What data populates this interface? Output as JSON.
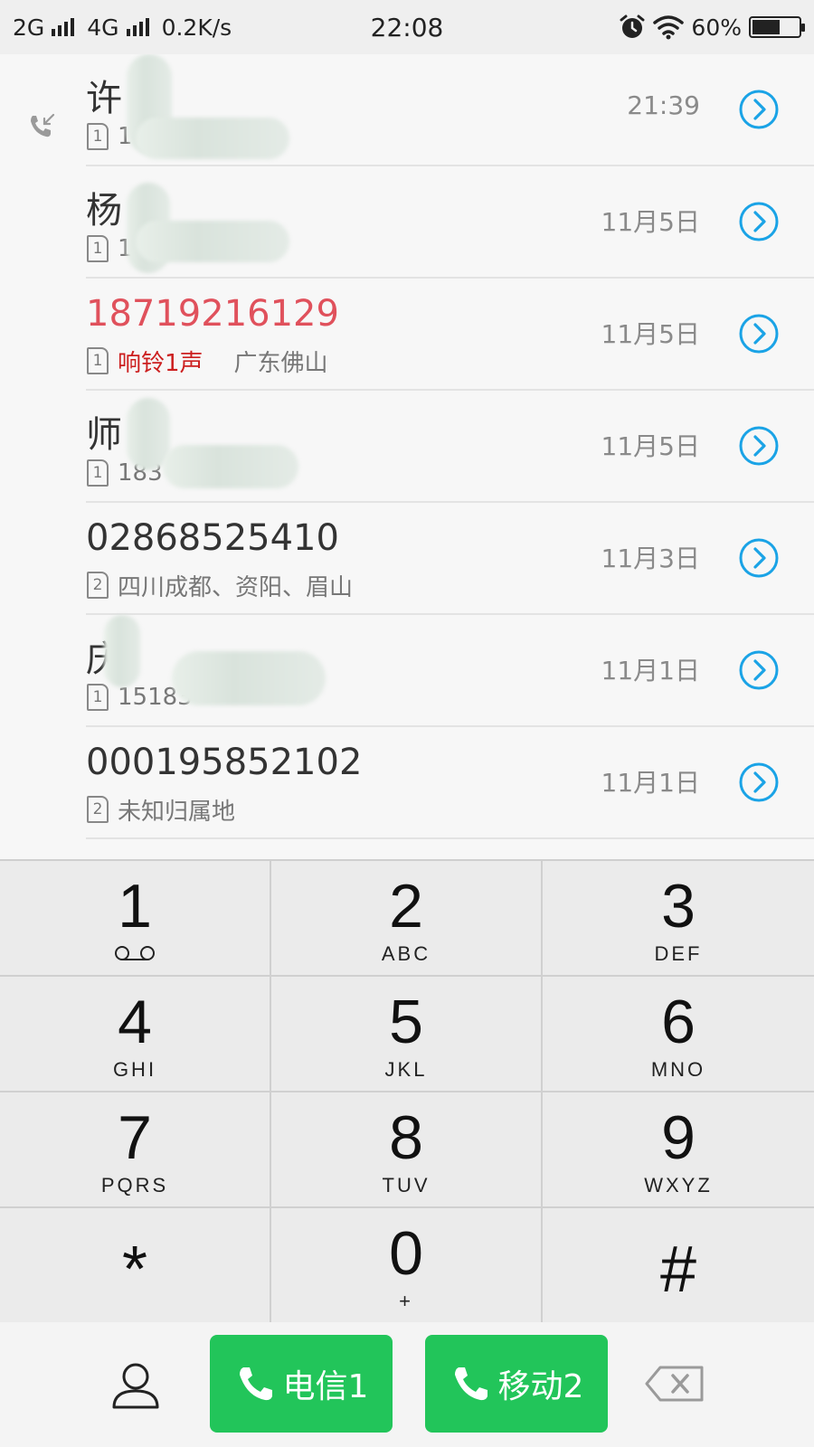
{
  "status_bar": {
    "network1": "2G",
    "network2": "4G",
    "speed": "0.2K/s",
    "time": "22:08",
    "battery_percent": "60%",
    "battery_level": 0.6,
    "icons": [
      "signal-icon",
      "alarm-icon",
      "wifi-icon",
      "battery-charging-icon"
    ]
  },
  "calls": [
    {
      "name": "许",
      "sub": "1",
      "sim": "1",
      "time": "21:39",
      "missed": false,
      "incoming": true
    },
    {
      "name": "杨",
      "sub": "1",
      "sim": "1",
      "time": "11月5日",
      "missed": false,
      "incoming": false
    },
    {
      "name": "18719216129",
      "ring": "响铃1声",
      "location": "广东佛山",
      "sim": "1",
      "time": "11月5日",
      "missed": true,
      "incoming": false
    },
    {
      "name": "师",
      "sub": "183",
      "sim": "1",
      "time": "11月5日",
      "missed": false,
      "incoming": false
    },
    {
      "name": "02868525410",
      "sub": "四川成都、资阳、眉山",
      "sim": "2",
      "time": "11月3日",
      "missed": false,
      "incoming": false
    },
    {
      "name": "庆",
      "sub": "15183",
      "sim": "1",
      "time": "11月1日",
      "missed": false,
      "incoming": false
    },
    {
      "name": "000195852102",
      "sub": "未知归属地",
      "sim": "2",
      "time": "11月1日",
      "missed": false,
      "incoming": false
    }
  ],
  "keypad": [
    {
      "digit": "1",
      "letters": ""
    },
    {
      "digit": "2",
      "letters": "ABC"
    },
    {
      "digit": "3",
      "letters": "DEF"
    },
    {
      "digit": "4",
      "letters": "GHI"
    },
    {
      "digit": "5",
      "letters": "JKL"
    },
    {
      "digit": "6",
      "letters": "MNO"
    },
    {
      "digit": "7",
      "letters": "PQRS"
    },
    {
      "digit": "8",
      "letters": "TUV"
    },
    {
      "digit": "9",
      "letters": "WXYZ"
    },
    {
      "digit": "*",
      "letters": ""
    },
    {
      "digit": "0",
      "letters": "+"
    },
    {
      "digit": "#",
      "letters": ""
    }
  ],
  "actions": {
    "call_sim1_label": "电信1",
    "call_sim2_label": "移动2",
    "call_color": "#22c55a"
  }
}
